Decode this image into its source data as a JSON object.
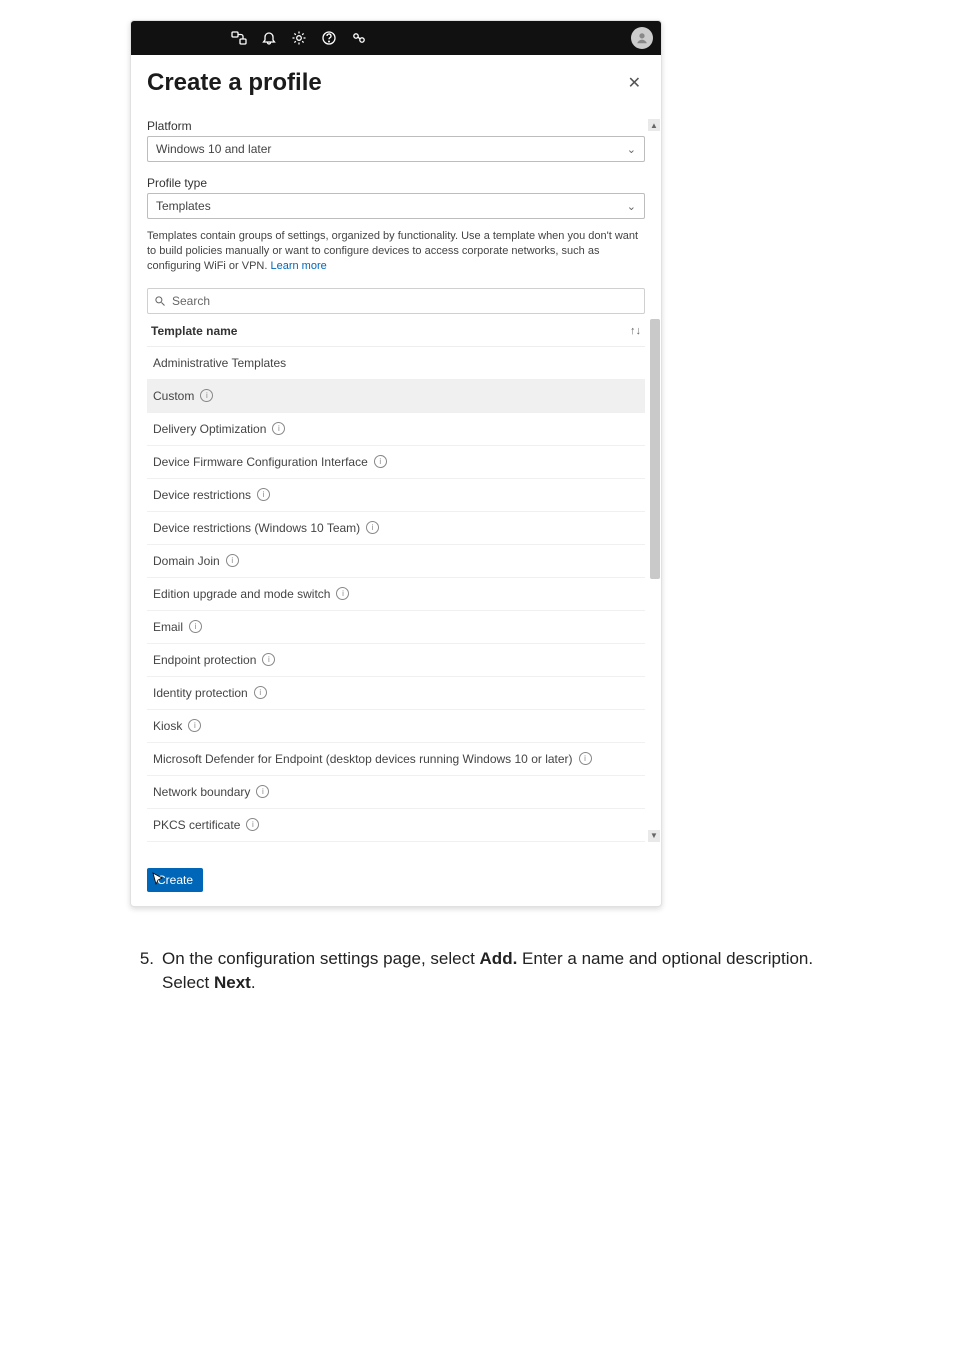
{
  "topbar": {
    "icons": [
      "connect-icon",
      "bell-icon",
      "gear-icon",
      "help-icon",
      "feedback-icon"
    ]
  },
  "panel": {
    "title": "Create a profile",
    "platform_label": "Platform",
    "platform_value": "Windows 10 and later",
    "profile_type_label": "Profile type",
    "profile_type_value": "Templates",
    "description_part1": "Templates contain groups of settings, organized by functionality. Use a template when you don't want to build policies manually or want to configure devices to access corporate networks, such as configuring WiFi or VPN. ",
    "description_link": "Learn more",
    "search_placeholder": "Search",
    "grid_header": "Template name",
    "sort_indicator": "↑↓",
    "rows": [
      {
        "label": "Administrative Templates",
        "info": false
      },
      {
        "label": "Custom",
        "info": true,
        "selected": true
      },
      {
        "label": "Delivery Optimization",
        "info": true
      },
      {
        "label": "Device Firmware Configuration Interface",
        "info": true
      },
      {
        "label": "Device restrictions",
        "info": true
      },
      {
        "label": "Device restrictions (Windows 10 Team)",
        "info": true
      },
      {
        "label": "Domain Join",
        "info": true
      },
      {
        "label": "Edition upgrade and mode switch",
        "info": true
      },
      {
        "label": "Email",
        "info": true
      },
      {
        "label": "Endpoint protection",
        "info": true
      },
      {
        "label": "Identity protection",
        "info": true
      },
      {
        "label": "Kiosk",
        "info": true
      },
      {
        "label": "Microsoft Defender for Endpoint (desktop devices running Windows 10 or later)",
        "info": true
      },
      {
        "label": "Network boundary",
        "info": true
      },
      {
        "label": "PKCS certificate",
        "info": true
      }
    ],
    "create_button": "Create"
  },
  "step": {
    "number": "5.",
    "text_parts": [
      "On the configuration settings page, select ",
      "Add.",
      " Enter a name and optional description. Select ",
      "Next",
      "."
    ]
  }
}
